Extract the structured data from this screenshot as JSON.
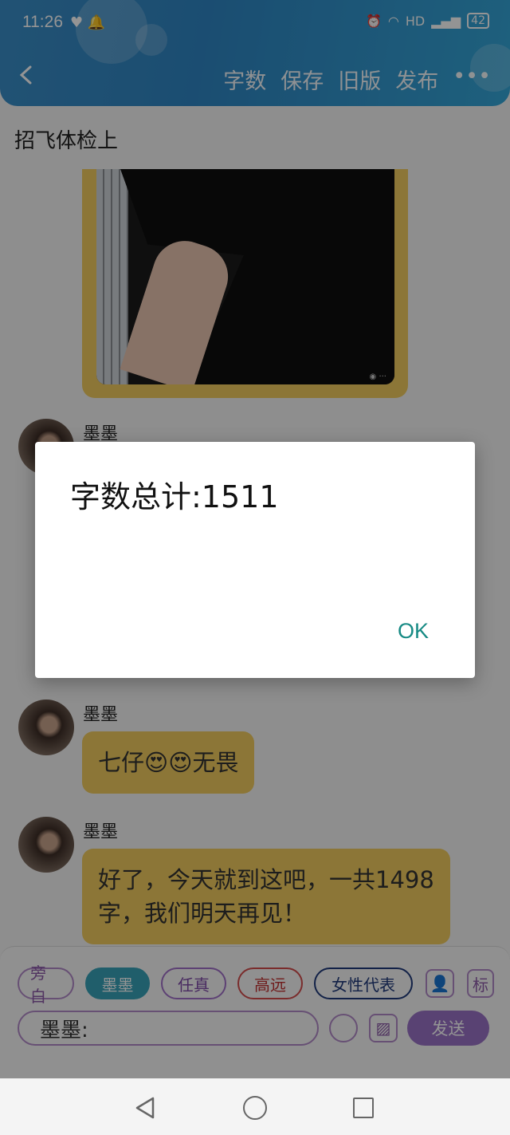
{
  "status_bar": {
    "time": "11:26",
    "battery": "42"
  },
  "toolbar": {
    "items": [
      "字数",
      "保存",
      "旧版",
      "发布"
    ],
    "more": "•••"
  },
  "page": {
    "title": "招飞体检上"
  },
  "messages": [
    {
      "name": "墨墨",
      "text": ""
    },
    {
      "name": "墨墨",
      "text": "七仔😍😍无畏"
    },
    {
      "name": "墨墨",
      "text": "好了，今天就到这吧，一共1498字，我们明天再见！"
    }
  ],
  "dialog": {
    "message": "字数总计:1511",
    "ok_label": "OK"
  },
  "input_area": {
    "roles": [
      "旁白",
      "墨墨",
      "任真",
      "高远",
      "女性代表"
    ],
    "tool_avatar": "👤",
    "tool_mark": "标",
    "input_value": "墨墨:",
    "send_label": "发送"
  },
  "colors": {
    "header": "#2f86c4",
    "bubble": "#f2cc5f",
    "accent": "#9a72c6",
    "ok": "#168a84"
  }
}
